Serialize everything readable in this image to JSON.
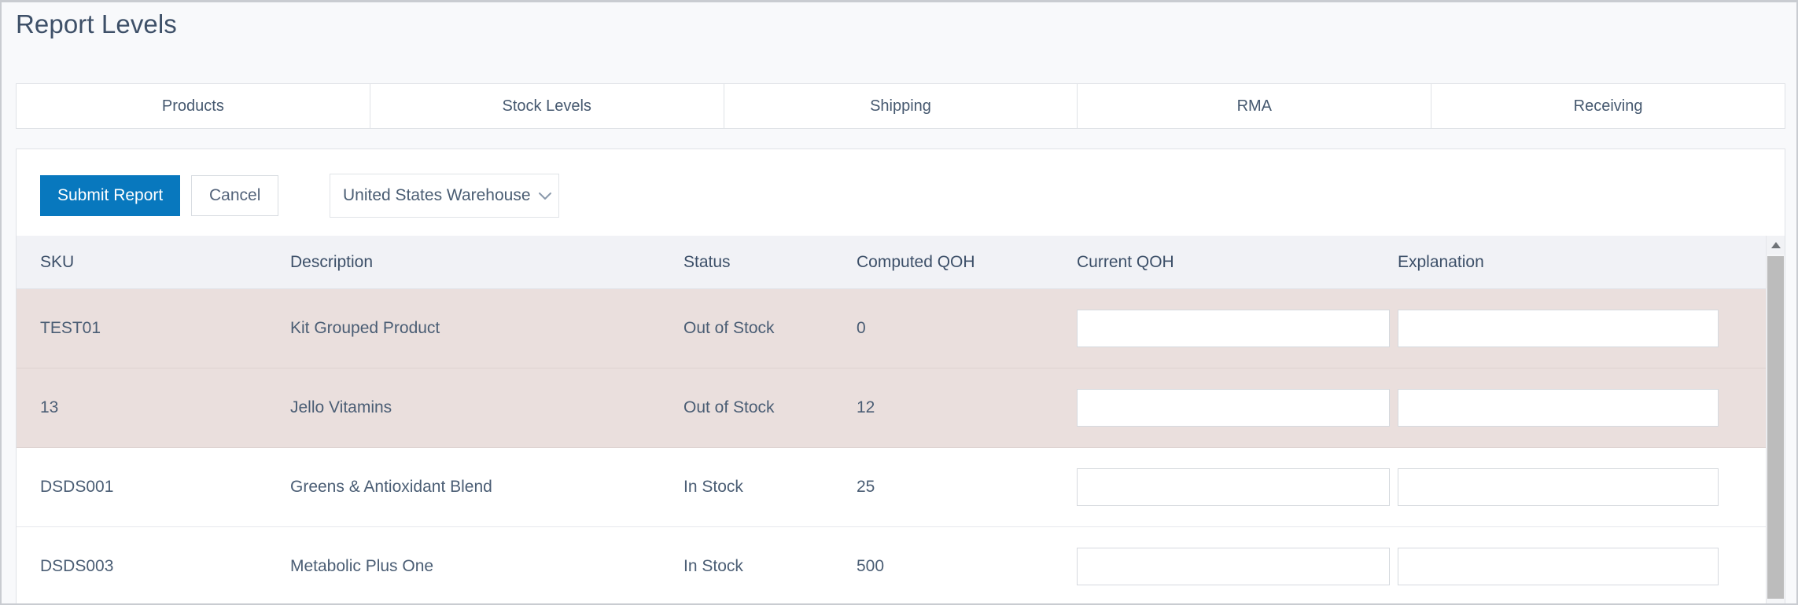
{
  "page": {
    "title": "Report Levels"
  },
  "tabs": [
    {
      "label": "Products",
      "active": false
    },
    {
      "label": "Stock Levels",
      "active": true
    },
    {
      "label": "Shipping",
      "active": false
    },
    {
      "label": "RMA",
      "active": false
    },
    {
      "label": "Receiving",
      "active": false
    }
  ],
  "toolbar": {
    "submit_label": "Submit Report",
    "cancel_label": "Cancel",
    "warehouse_selected": "United States Warehouse",
    "warehouse_icon": "chevron-down-icon"
  },
  "table": {
    "columns": [
      "SKU",
      "Description",
      "Status",
      "Computed QOH",
      "Current QOH",
      "Explanation"
    ],
    "rows": [
      {
        "sku": "TEST01",
        "description": "Kit Grouped Product",
        "status": "Out of Stock",
        "computed_qoh": "0",
        "current_qoh": "",
        "current_qoh_placeholder": "",
        "explanation": "",
        "explanation_placeholder": "",
        "alert": true
      },
      {
        "sku": "13",
        "description": "Jello Vitamins",
        "status": "Out of Stock",
        "computed_qoh": "12",
        "current_qoh": "",
        "current_qoh_placeholder": "",
        "explanation": "",
        "explanation_placeholder": "",
        "alert": true
      },
      {
        "sku": "DSDS001",
        "description": "Greens & Antioxidant Blend",
        "status": "In Stock",
        "computed_qoh": "25",
        "current_qoh": "",
        "current_qoh_placeholder": "",
        "explanation": "",
        "explanation_placeholder": "",
        "alert": false
      },
      {
        "sku": "DSDS003",
        "description": "Metabolic Plus One",
        "status": "In Stock",
        "computed_qoh": "500",
        "current_qoh": "",
        "current_qoh_placeholder": "",
        "explanation": "",
        "explanation_placeholder": "",
        "alert": false
      }
    ]
  },
  "scrollbar": {
    "up_arrow_icon": "triangle-up-icon",
    "thumb_name": "vertical-scroll-thumb"
  },
  "colors": {
    "accent": "#0878be",
    "text": "#45586f",
    "alert_row": "#eadfdd",
    "header_row": "#f1f2f6",
    "page_background": "#f8f9fb"
  }
}
